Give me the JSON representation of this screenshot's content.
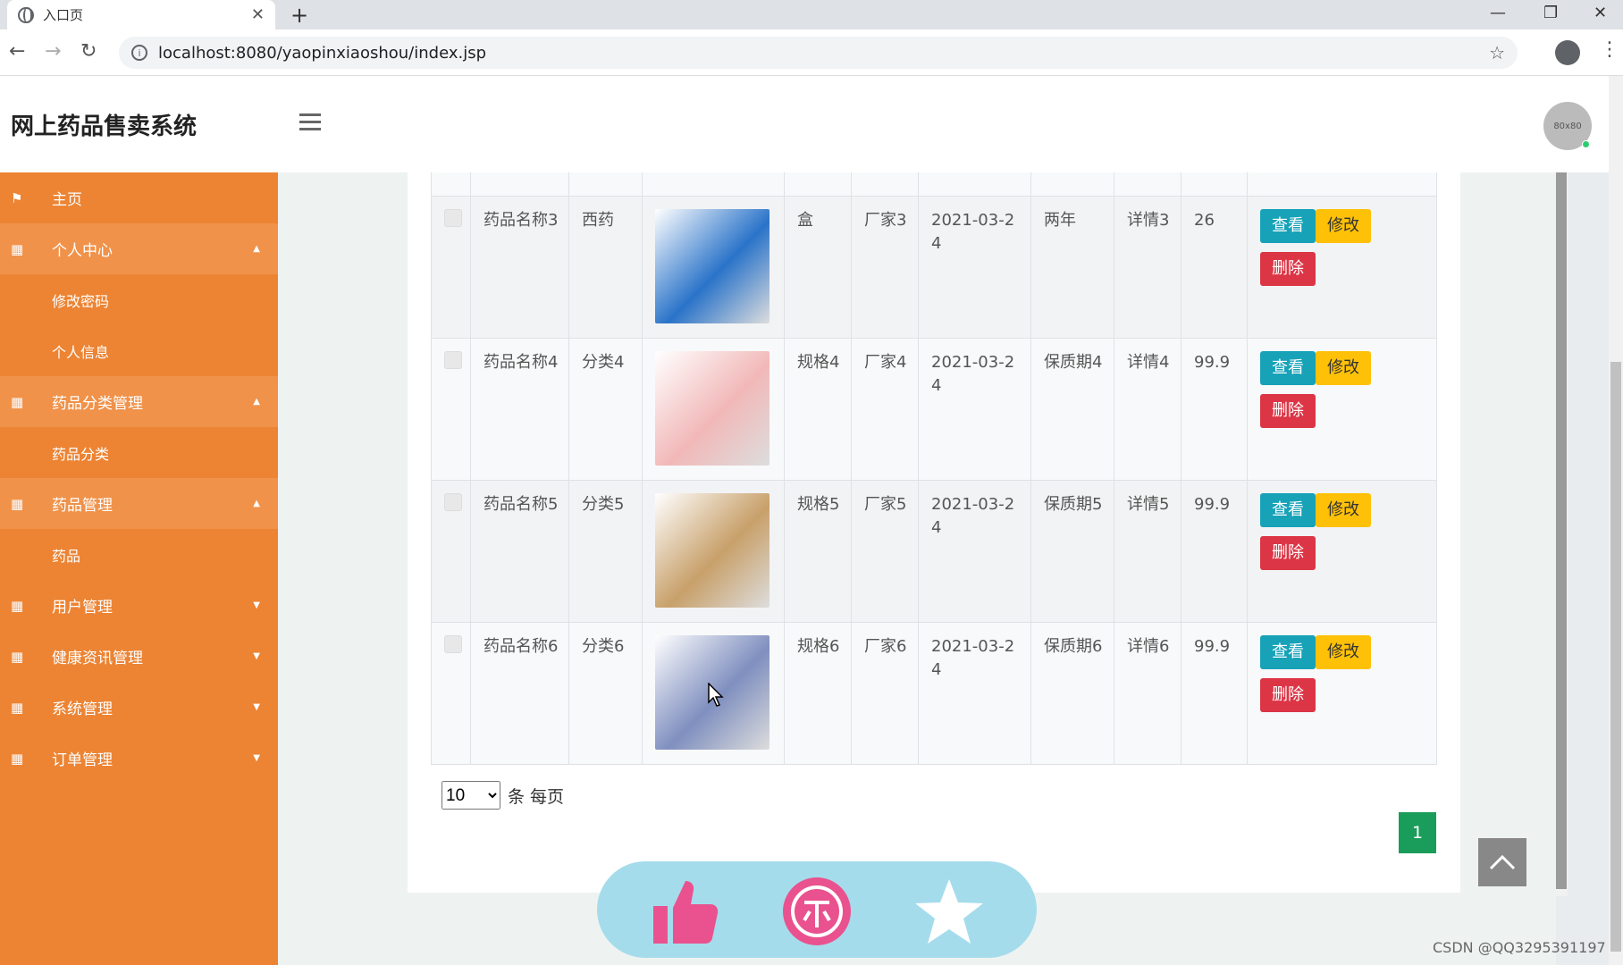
{
  "browser": {
    "tab_title": "入口页",
    "url": "localhost:8080/yaopinxiaoshou/index.jsp"
  },
  "app": {
    "brand": "网上药品售卖系统",
    "avatar_text": "80x80"
  },
  "sidebar": {
    "items": [
      {
        "label": "主页",
        "icon": "flag-icon"
      },
      {
        "label": "个人中心",
        "icon": "grid-icon",
        "expanded": true,
        "children": [
          "修改密码",
          "个人信息"
        ]
      },
      {
        "label": "药品分类管理",
        "icon": "grid-icon",
        "expanded": true,
        "children": [
          "药品分类"
        ]
      },
      {
        "label": "药品管理",
        "icon": "grid-icon",
        "expanded": true,
        "children": [
          "药品"
        ]
      },
      {
        "label": "用户管理",
        "icon": "grid-icon",
        "expanded": false
      },
      {
        "label": "健康资讯管理",
        "icon": "grid-icon",
        "expanded": false
      },
      {
        "label": "系统管理",
        "icon": "grid-icon",
        "expanded": false
      },
      {
        "label": "订单管理",
        "icon": "grid-icon",
        "expanded": false
      }
    ]
  },
  "table": {
    "rows": [
      {
        "name": "药品名称3",
        "category": "西药",
        "spec": "盒",
        "maker": "厂家3",
        "date": "2021-03-24",
        "shelf": "两年",
        "detail": "详情3",
        "price": "26",
        "image_color": "#2a73c9"
      },
      {
        "name": "药品名称4",
        "category": "分类4",
        "spec": "规格4",
        "maker": "厂家4",
        "date": "2021-03-24",
        "shelf": "保质期4",
        "detail": "详情4",
        "price": "99.9",
        "image_color": "#f2b8b8"
      },
      {
        "name": "药品名称5",
        "category": "分类5",
        "spec": "规格5",
        "maker": "厂家5",
        "date": "2021-03-24",
        "shelf": "保质期5",
        "detail": "详情5",
        "price": "99.9",
        "image_color": "#c8a06a"
      },
      {
        "name": "药品名称6",
        "category": "分类6",
        "spec": "规格6",
        "maker": "厂家6",
        "date": "2021-03-24",
        "shelf": "保质期6",
        "detail": "详情6",
        "price": "99.9",
        "image_color": "#7f8fbf"
      }
    ],
    "actions": {
      "view": "查看",
      "edit": "修改",
      "delete": "删除"
    }
  },
  "pager": {
    "page_size": "10",
    "page_size_suffix": "条 每页",
    "current_page": "1"
  },
  "watermark": "CSDN @QQ3295391197",
  "colors": {
    "sidebar": "#ec8434",
    "view": "#17a2b8",
    "edit": "#ffc107",
    "delete": "#dc3545",
    "page_active": "#1a9c5a"
  }
}
